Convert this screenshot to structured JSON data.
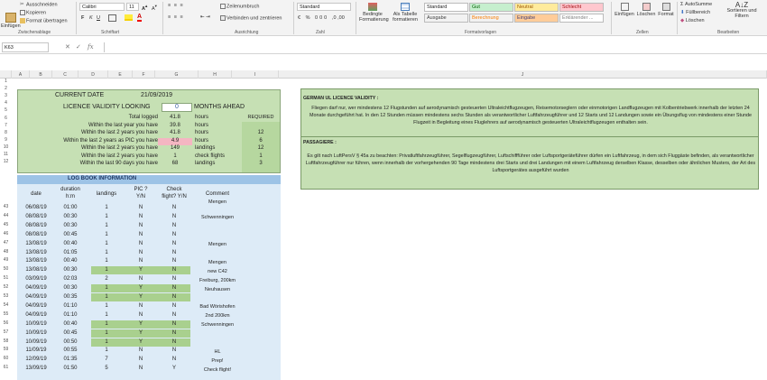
{
  "ribbon": {
    "clipboard": {
      "paste": "Einfügen",
      "cut": "Ausschneiden",
      "copy": "Kopieren",
      "format_painter": "Format übertragen",
      "group": "Zwischenablage"
    },
    "font": {
      "name": "Calibri",
      "size": "11",
      "group": "Schriftart"
    },
    "alignment": {
      "wrap": "Zeilenumbruch",
      "merge": "Verbinden und zentrieren",
      "group": "Ausrichtung"
    },
    "number": {
      "format": "Standard",
      "group": "Zahl"
    },
    "styles": {
      "conditional": "Bedingte Formatierung",
      "as_table": "Als Tabelle formatieren",
      "group": "Formatvorlagen",
      "cells": [
        {
          "label": "Standard",
          "bg": "#ffffff",
          "fg": "#222222"
        },
        {
          "label": "Gut",
          "bg": "#c6efce",
          "fg": "#006100"
        },
        {
          "label": "Neutral",
          "bg": "#ffeb9c",
          "fg": "#9c5700"
        },
        {
          "label": "Schlecht",
          "bg": "#ffc7ce",
          "fg": "#9c0006"
        },
        {
          "label": "Ausgabe",
          "bg": "#f2f2f2",
          "fg": "#3f3f3f"
        },
        {
          "label": "Berechnung",
          "bg": "#f2f2f2",
          "fg": "#fa7d00"
        },
        {
          "label": "Eingabe",
          "bg": "#ffcc99",
          "fg": "#3f3f76"
        },
        {
          "label": "Erklärender ...",
          "bg": "#ffffff",
          "fg": "#7f7f7f"
        }
      ]
    },
    "cells_group": {
      "insert": "Einfügen",
      "delete": "Löschen",
      "format": "Format",
      "group": "Zellen"
    },
    "editing": {
      "autosum": "AutoSumme",
      "fill": "Füllbereich",
      "clear": "Löschen",
      "sort": "Sortieren und Filtern",
      "group": "Bearbeiten"
    }
  },
  "formula_bar": {
    "name_box": "K63",
    "fx": "fx",
    "value": ""
  },
  "columns": [
    "A",
    "B",
    "C",
    "D",
    "E",
    "F",
    "G",
    "H",
    "I",
    "J"
  ],
  "summary": {
    "current_date_label": "CURRENT DATE",
    "current_date": "21/09/2019",
    "validity_label": "LICENCE VALIDITY LOOKING",
    "validity_value": "0",
    "months_ahead": "MONTHS AHEAD",
    "required_label": "REQUIRED",
    "rows": [
      {
        "label": "Total logged",
        "value": "41.8",
        "unit": "hours",
        "required": ""
      },
      {
        "label": "Within the last year you have",
        "value": "39.8",
        "unit": "hours",
        "required": ""
      },
      {
        "label": "Within the last 2 years you have",
        "value": "41.8",
        "unit": "hours",
        "required": "12"
      },
      {
        "label": "Within the last 2 years as PIC you have",
        "value": "4.9",
        "unit": "hours",
        "required": "6"
      },
      {
        "label": "Within the last 2 years you have",
        "value": "149",
        "unit": "landings",
        "required": "12"
      },
      {
        "label": "Within the last 2 years you have",
        "value": "1",
        "unit": "check flights",
        "required": "1"
      },
      {
        "label": "Within the last 90 days you have",
        "value": "68",
        "unit": "landings",
        "required": "3"
      }
    ]
  },
  "logbook": {
    "title": "LOG BOOK INFORMATION",
    "headers": {
      "date": "date",
      "duration": "duration",
      "duration_unit": "h:m",
      "landings": "landings",
      "pic": "PIC ?",
      "pic_yn": "Y/N",
      "check": "Check",
      "check_yn": "flight? Y/N",
      "comment": "Comment"
    },
    "top_comment": "Mengen",
    "rows": [
      {
        "row": "43",
        "date": "06/08/19",
        "dur": "01:00",
        "land": "1",
        "pic": "N",
        "chk": "N",
        "comment": ""
      },
      {
        "row": "44",
        "date": "08/08/19",
        "dur": "00:30",
        "land": "1",
        "pic": "N",
        "chk": "N",
        "comment": "Schwenningen"
      },
      {
        "row": "45",
        "date": "08/08/19",
        "dur": "00:30",
        "land": "1",
        "pic": "N",
        "chk": "N",
        "comment": ""
      },
      {
        "row": "46",
        "date": "08/08/19",
        "dur": "00:45",
        "land": "1",
        "pic": "N",
        "chk": "N",
        "comment": ""
      },
      {
        "row": "47",
        "date": "13/08/19",
        "dur": "00:40",
        "land": "1",
        "pic": "N",
        "chk": "N",
        "comment": "Mengen"
      },
      {
        "row": "48",
        "date": "13/08/19",
        "dur": "01:05",
        "land": "1",
        "pic": "N",
        "chk": "N",
        "comment": ""
      },
      {
        "row": "49",
        "date": "13/08/19",
        "dur": "00:40",
        "land": "1",
        "pic": "N",
        "chk": "N",
        "comment": "Mengen"
      },
      {
        "row": "50",
        "date": "13/08/19",
        "dur": "00:30",
        "land": "1",
        "pic": "Y",
        "chk": "N",
        "comment": "new C42"
      },
      {
        "row": "51",
        "date": "03/09/19",
        "dur": "02:03",
        "land": "2",
        "pic": "N",
        "chk": "N",
        "comment": "Freiburg, 200km"
      },
      {
        "row": "52",
        "date": "04/09/19",
        "dur": "00:30",
        "land": "1",
        "pic": "Y",
        "chk": "N",
        "comment": "Neuhausen"
      },
      {
        "row": "53",
        "date": "04/09/19",
        "dur": "00:35",
        "land": "1",
        "pic": "Y",
        "chk": "N",
        "comment": ""
      },
      {
        "row": "54",
        "date": "04/09/19",
        "dur": "01:10",
        "land": "1",
        "pic": "N",
        "chk": "N",
        "comment": "Bad Wörishofen"
      },
      {
        "row": "55",
        "date": "04/09/19",
        "dur": "01:10",
        "land": "1",
        "pic": "N",
        "chk": "N",
        "comment": "2nd 200km"
      },
      {
        "row": "56",
        "date": "10/09/19",
        "dur": "00:40",
        "land": "1",
        "pic": "Y",
        "chk": "N",
        "comment": "Schwenningen"
      },
      {
        "row": "57",
        "date": "10/09/19",
        "dur": "00:45",
        "land": "1",
        "pic": "Y",
        "chk": "N",
        "comment": ""
      },
      {
        "row": "58",
        "date": "10/09/19",
        "dur": "00:50",
        "land": "1",
        "pic": "Y",
        "chk": "N",
        "comment": ""
      },
      {
        "row": "59",
        "date": "11/09/19",
        "dur": "00:55",
        "land": "1",
        "pic": "N",
        "chk": "N",
        "comment": "HL"
      },
      {
        "row": "60",
        "date": "12/09/19",
        "dur": "01:35",
        "land": "7",
        "pic": "N",
        "chk": "N",
        "comment": "Prep!"
      },
      {
        "row": "61",
        "date": "13/09/19",
        "dur": "01:50",
        "land": "5",
        "pic": "N",
        "chk": "Y",
        "comment": "Check flight!"
      }
    ]
  },
  "notes": {
    "german_title": "GERMAN UL LICENCE VALIDITY :",
    "german_text": "Fliegen darf nur, wer mindestens 12 Flugstunden auf aerodynamisch gesteuerten Ultraleichtflugzeugen, Reisemotorseglern oder einmotorigen Landflugzeugen mit Kolbentriebwerk innerhalb der letzten 24 Monate durchgeführt hat. In den 12 Stunden müssen mindestens sechs Stunden als verantwortlicher Luftfahrzeugführer und 12 Starts und 12 Landungen sowie ein Übungsflug von mindestens einer Stunde Flugzeit in Begleitung eines Fluglehrers auf aerodynamisch gesteuerten Ultraleichtflugzeugen enthalten sein.",
    "passenger_title": "PASSAGIERE :",
    "passenger_text": "Es gilt nach LuftPersV § 45a zu beachten: Privatluftfahrzeugführer, Segelflugzeugführer, Luftschiffführer oder Luftsportgeräteführer dürfen ein Luftfahrzeug, in dem sich Fluggäste befinden, als verantwortlicher Luftfahrzeugführer nur führen, wenn innerhalb der vorhergehenden 90 Tage mindestens drei Starts und drei Landungen mit einem Luftfahrzeug derselben Klasse, desselben oder ähnlichen Musters, der Art des Luftsportgerätes ausgeführt wurden"
  },
  "colors": {
    "green_box": "#c6e0b4",
    "green_cell": "#a9d08e",
    "blue_header": "#9dc3e6",
    "blue_body": "#ddebf7",
    "pink_alert": "#f4b6c2"
  }
}
